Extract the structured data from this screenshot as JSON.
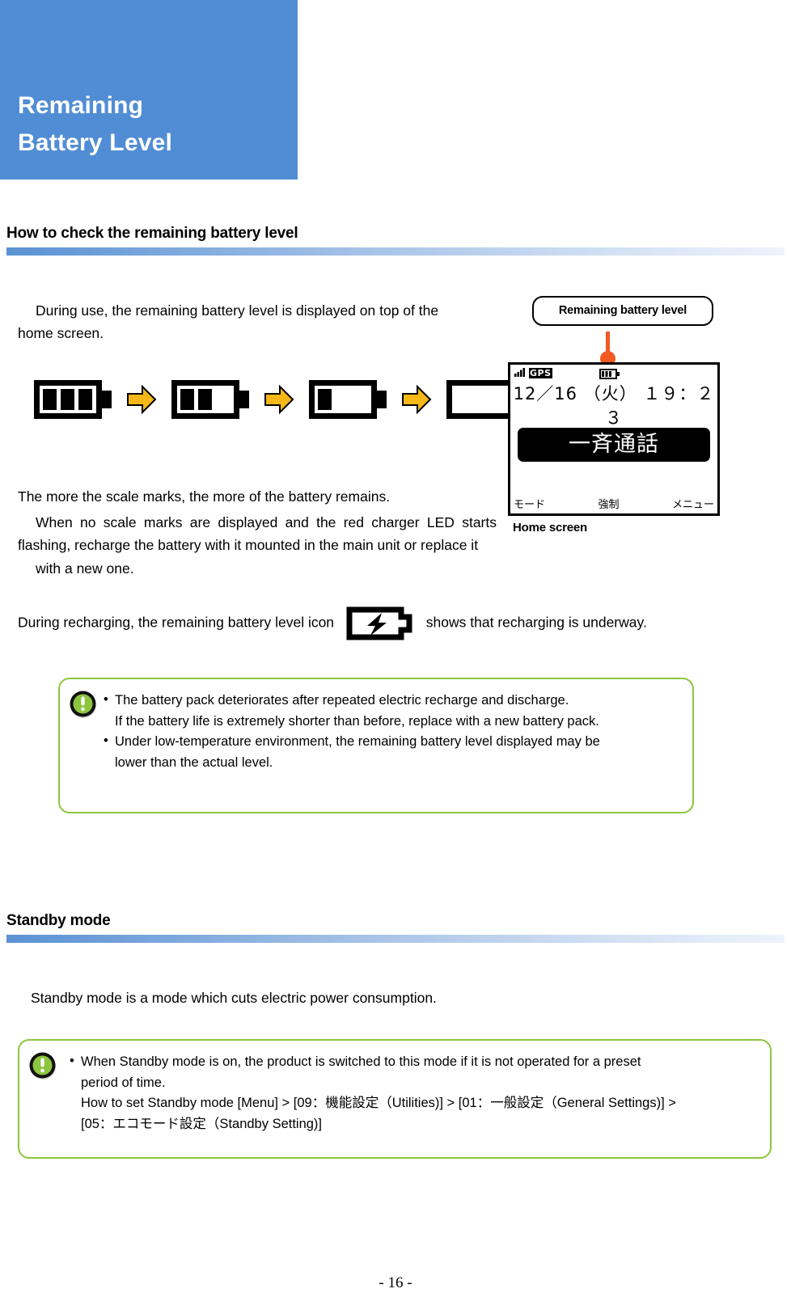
{
  "chapter": {
    "title_line1": "Remaining",
    "title_line2": "Battery Level",
    "banner_color": "#518dd4"
  },
  "sections": [
    {
      "id": "check",
      "heading": "How to check the remaining battery level"
    },
    {
      "id": "standby",
      "heading": "Standby mode"
    }
  ],
  "body": {
    "intro": "During use, the remaining battery level is displayed on top of the home screen.",
    "scale_marks": "The more the scale marks, the more of the battery remains.",
    "no_scale_marks": "When no scale marks are displayed and the red charger LED starts flashing, recharge the battery with it mounted in the main unit or replace it",
    "no_scale_marks_last": "with a new one.",
    "recharging_before": "During recharging, the remaining battery level icon",
    "recharging_after": "shows that recharging is underway.",
    "standby_intro": "Standby mode is a mode which cuts electric power consumption."
  },
  "battery_sequence": {
    "icons": [
      {
        "name": "battery-full-3-bars",
        "bars": 3
      },
      {
        "name": "battery-2-bars",
        "bars": 2
      },
      {
        "name": "battery-1-bar",
        "bars": 1
      },
      {
        "name": "battery-empty",
        "bars": 0
      }
    ],
    "arrow_color": "#f5b816",
    "charging_icon_name": "battery-charging-icon"
  },
  "device": {
    "callout_label": "Remaining battery level",
    "callout_color": "#f15a22",
    "caption": "Home screen",
    "screen": {
      "signal_icon": "signal-bars-icon",
      "gps_label": "GPS",
      "battery_icon": "battery-indicator-icon",
      "date": "12／16",
      "weekday": "（火）",
      "time": "１９：２３",
      "banner": "一斉通話",
      "softkey_left": "モード",
      "softkey_center": "強制",
      "softkey_right": "メニュー"
    }
  },
  "notes": [
    {
      "icon": "exclamation-circle-icon",
      "icon_color": "#8cc63e",
      "border_color": "#8cc63e",
      "lines": [
        {
          "bullet": true,
          "text": "The battery pack deteriorates after repeated electric recharge and discharge."
        },
        {
          "bullet": false,
          "text": "If the battery life is extremely shorter than before, replace with a new battery pack."
        },
        {
          "bullet": true,
          "text": "Under low-temperature environment, the remaining battery level displayed may be"
        },
        {
          "bullet": false,
          "text": "lower than the actual level."
        }
      ]
    },
    {
      "icon": "exclamation-circle-icon",
      "icon_color": "#8cc63e",
      "border_color": "#8cc63e",
      "lines": [
        {
          "bullet": true,
          "text": "When Standby mode is on, the product is switched to this mode if it is not operated for a preset"
        },
        {
          "bullet": false,
          "text": "period of time."
        },
        {
          "bullet": false,
          "text": "How to set Standby mode [Menu] > [09：機能設定（Utilities)] > [01：一般設定（General Settings)] >"
        },
        {
          "bullet": false,
          "text": "[05：エコモード設定（Standby Setting)]"
        }
      ]
    }
  ],
  "footer": {
    "page_number": "- 16 -"
  }
}
